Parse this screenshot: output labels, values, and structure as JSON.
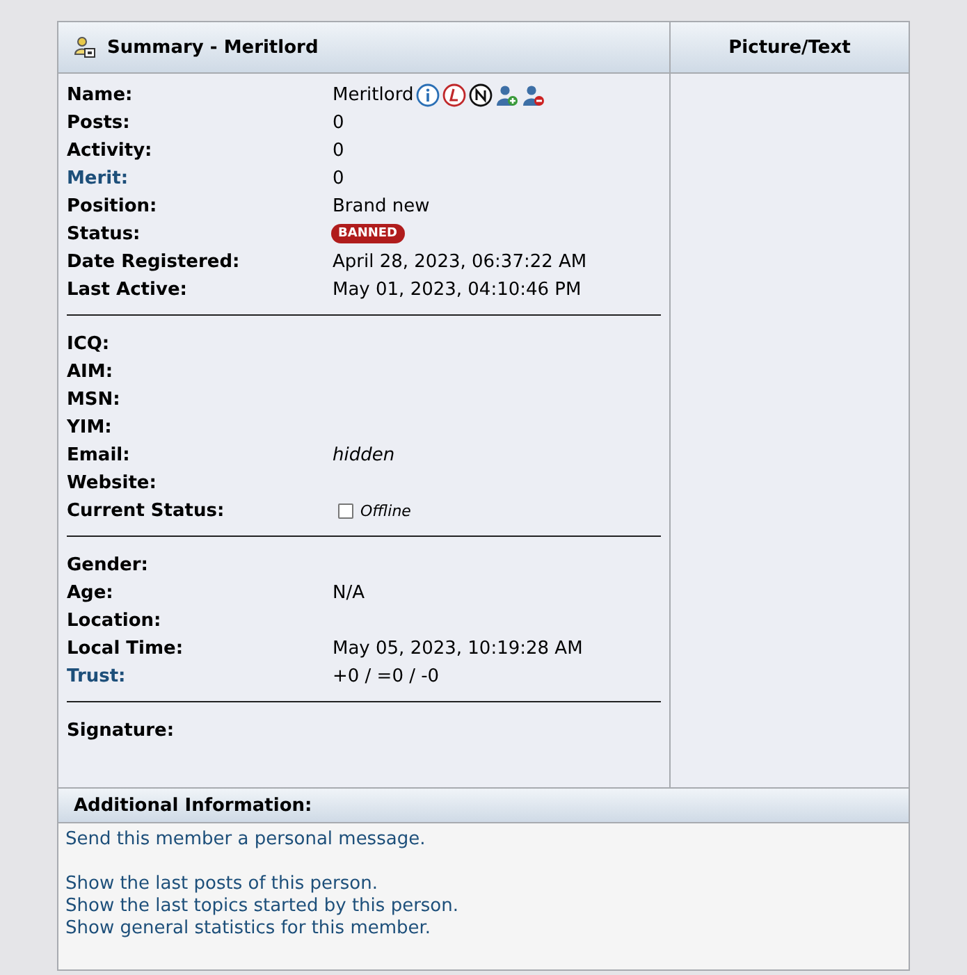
{
  "summary": {
    "title": "Summary - Meritlord"
  },
  "picture_header": "Picture/Text",
  "sections": [
    {
      "rows": [
        {
          "label": "Name:",
          "link": false,
          "value": "Meritlord",
          "kind": "name"
        },
        {
          "label": "Posts:",
          "link": false,
          "value": "0",
          "kind": "text"
        },
        {
          "label": "Activity:",
          "link": false,
          "value": "0",
          "kind": "text"
        },
        {
          "label": "Merit:",
          "link": true,
          "value": "0",
          "kind": "text"
        },
        {
          "label": "Position:",
          "link": false,
          "value": "Brand new",
          "kind": "text"
        },
        {
          "label": "Status:",
          "link": false,
          "value": "BANNED",
          "kind": "badge"
        },
        {
          "label": "Date Registered:",
          "link": false,
          "value": "April 28, 2023, 06:37:22 AM",
          "kind": "text"
        },
        {
          "label": "Last Active:",
          "link": false,
          "value": "May 01, 2023, 04:10:46 PM",
          "kind": "text"
        }
      ]
    },
    {
      "rows": [
        {
          "label": "ICQ:",
          "link": false
        },
        {
          "label": "AIM:",
          "link": false
        },
        {
          "label": "MSN:",
          "link": false
        },
        {
          "label": "YIM:",
          "link": false
        },
        {
          "label": "Email:",
          "link": false,
          "value": "hidden",
          "kind": "italic"
        },
        {
          "label": "Website:",
          "link": false
        },
        {
          "label": "Current Status:",
          "link": false,
          "value": "Offline",
          "kind": "presence"
        }
      ]
    },
    {
      "rows": [
        {
          "label": "Gender:",
          "link": false
        },
        {
          "label": "Age:",
          "link": false,
          "value": "N/A",
          "kind": "text"
        },
        {
          "label": "Location:",
          "link": false
        },
        {
          "label": "Local Time:",
          "link": false,
          "value": "May 05, 2023, 10:19:28 AM",
          "kind": "text"
        },
        {
          "label": "Trust:",
          "link": true,
          "value": "+0 / =0 / -0",
          "kind": "text"
        }
      ]
    },
    {
      "rows": [
        {
          "label": "Signature:",
          "link": false
        }
      ]
    }
  ],
  "additional": {
    "title": "Additional Information:",
    "link_groups": [
      [
        "Send this member a personal message."
      ],
      [
        "Show the last posts of this person.",
        "Show the last topics started by this person.",
        "Show general statistics for this member."
      ]
    ]
  }
}
